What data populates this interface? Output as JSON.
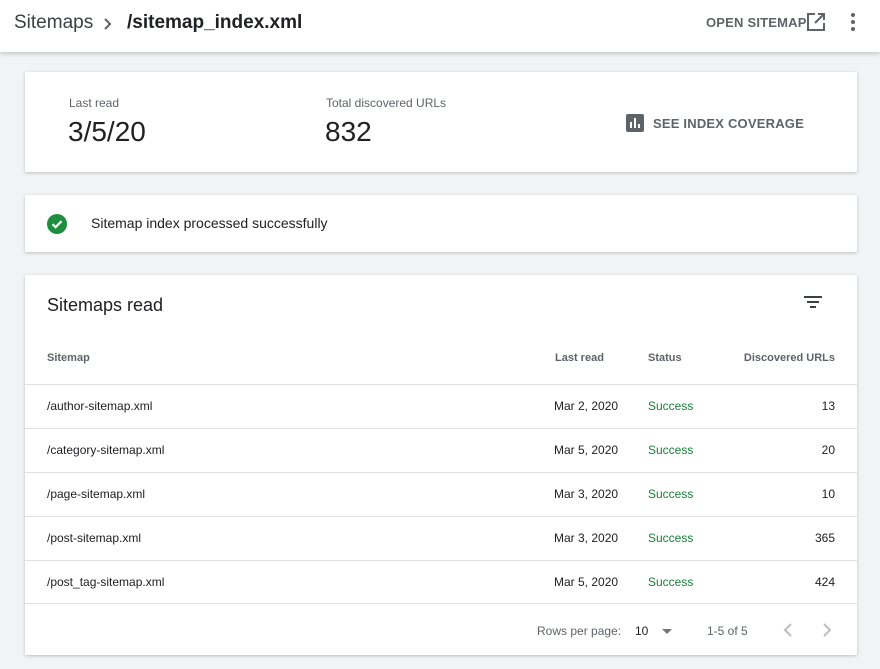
{
  "header": {
    "breadcrumb_root": "Sitemaps",
    "breadcrumb_current": "/sitemap_index.xml",
    "open_sitemap_label": "OPEN SITEMAP"
  },
  "stats": {
    "last_read_label": "Last read",
    "last_read_value": "3/5/20",
    "total_urls_label": "Total discovered URLs",
    "total_urls_value": "832",
    "coverage_label": "SEE INDEX COVERAGE"
  },
  "status": {
    "message": "Sitemap index processed successfully",
    "color": "#1e8e3e"
  },
  "table": {
    "title": "Sitemaps read",
    "columns": {
      "sitemap": "Sitemap",
      "last_read": "Last read",
      "status": "Status",
      "discovered": "Discovered URLs"
    },
    "rows": [
      {
        "sitemap": "/author-sitemap.xml",
        "last_read": "Mar 2, 2020",
        "status": "Success",
        "discovered": "13"
      },
      {
        "sitemap": "/category-sitemap.xml",
        "last_read": "Mar 5, 2020",
        "status": "Success",
        "discovered": "20"
      },
      {
        "sitemap": "/page-sitemap.xml",
        "last_read": "Mar 3, 2020",
        "status": "Success",
        "discovered": "10"
      },
      {
        "sitemap": "/post-sitemap.xml",
        "last_read": "Mar 3, 2020",
        "status": "Success",
        "discovered": "365"
      },
      {
        "sitemap": "/post_tag-sitemap.xml",
        "last_read": "Mar 5, 2020",
        "status": "Success",
        "discovered": "424"
      }
    ],
    "footer": {
      "rows_per_page_label": "Rows per page:",
      "rows_per_page_value": "10",
      "range": "1-5 of 5"
    }
  },
  "colors": {
    "success_text": "#188038",
    "muted_text": "#5f6368"
  }
}
